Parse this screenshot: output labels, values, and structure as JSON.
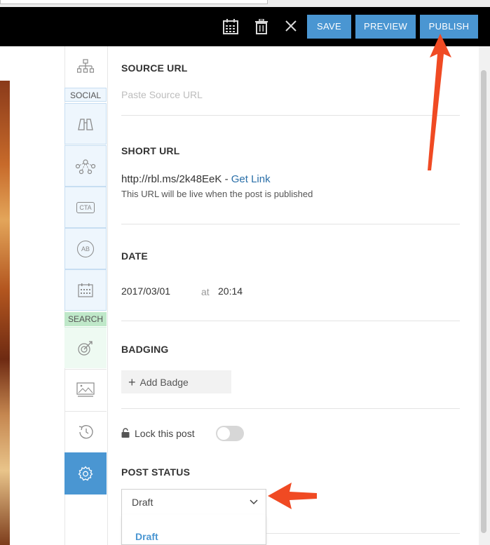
{
  "toolbar": {
    "save_label": "SAVE",
    "preview_label": "PREVIEW",
    "publish_label": "PUBLISH",
    "button_color": "#4a96d2"
  },
  "rail": {
    "social_label": "SOCIAL",
    "search_label": "SEARCH",
    "cta_label": "CTA",
    "ab_label": "AB",
    "active_color": "#4a96d2"
  },
  "source_url": {
    "title": "SOURCE URL",
    "placeholder": "Paste Source URL"
  },
  "short_url": {
    "title": "SHORT URL",
    "url": "http://rbl.ms/2k48EeK",
    "separator": " - ",
    "link_label": "Get Link",
    "note": "This URL will be live when the post is published"
  },
  "date": {
    "title": "DATE",
    "value": "2017/03/01",
    "at_label": "at",
    "time": "20:14"
  },
  "badging": {
    "title": "BADGING",
    "add_label": "Add Badge"
  },
  "lock": {
    "label": "Lock this post"
  },
  "post_status": {
    "title": "POST STATUS",
    "selected": "Draft",
    "options": [
      "Draft"
    ]
  },
  "annotation_color": "#f04a23"
}
